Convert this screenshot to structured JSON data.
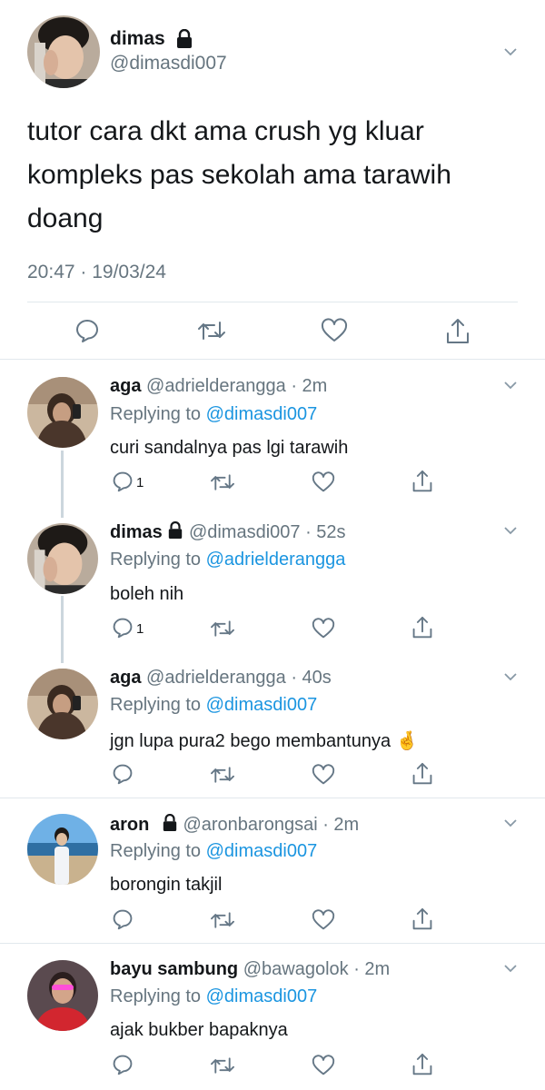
{
  "main_tweet": {
    "display_name": "dimas",
    "handle": "@dimasdi007",
    "text": "tutor cara dkt ama crush yg kluar kompleks pas sekolah ama tarawih doang",
    "timestamp": "20:47 · 19/03/24"
  },
  "replies": [
    {
      "display_name": "aga",
      "handle_time": "@adrielderangga · 2m",
      "replying_prefix": "Replying to ",
      "replying_to": "@dimasdi007",
      "text": "curi sandalnya pas lgi tarawih",
      "reply_count": "1"
    },
    {
      "display_name": "dimas",
      "handle_time": "@dimasdi007 · 52s",
      "replying_prefix": "Replying to ",
      "replying_to": "@adrielderangga",
      "text": "boleh nih",
      "reply_count": "1"
    },
    {
      "display_name": "aga",
      "handle_time": "@adrielderangga · 40s",
      "replying_prefix": "Replying to ",
      "replying_to": "@dimasdi007",
      "text": "jgn lupa pura2 bego membantunya",
      "emoji": "🤞"
    },
    {
      "display_name": "aron",
      "handle_time": "@aronbarongsai · 2m",
      "replying_prefix": "Replying to ",
      "replying_to": "@dimasdi007",
      "text": "borongin takjil"
    },
    {
      "display_name": "bayu sambung",
      "handle_time": "@bawagolok · 2m",
      "replying_prefix": "Replying to ",
      "replying_to": "@dimasdi007",
      "text": "ajak bukber bapaknya"
    }
  ],
  "icons": {
    "reply": "reply-icon",
    "retweet": "retweet-icon",
    "like": "like-icon",
    "share": "share-icon",
    "caret": "chevron-down-icon",
    "lock": "lock-icon"
  },
  "colors": {
    "link": "#1b95e0",
    "secondary_text": "#66757f",
    "divider": "#e1e8ed",
    "thread_line": "#ccd6dd"
  }
}
